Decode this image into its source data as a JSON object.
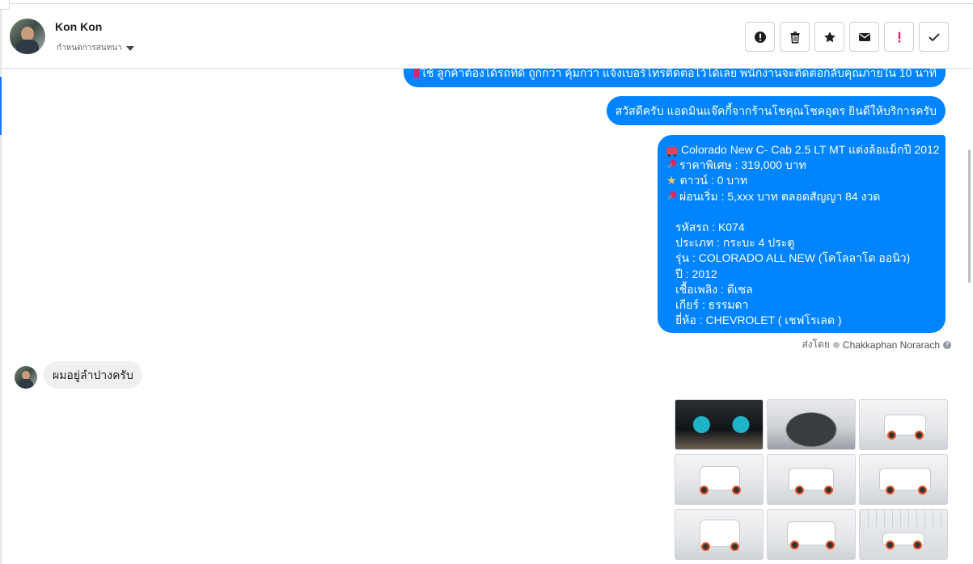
{
  "header": {
    "contact_name": "Kon Kon",
    "stage_label": "กำหนดการสนทนา"
  },
  "actions": [
    {
      "name": "spam-button",
      "icon": "alert-circle-icon"
    },
    {
      "name": "delete-button",
      "icon": "trash-icon"
    },
    {
      "name": "star-button",
      "icon": "star-icon"
    },
    {
      "name": "mark-unread-button",
      "icon": "envelope-icon"
    },
    {
      "name": "follow-up-button",
      "icon": "exclamation-icon"
    },
    {
      "name": "mark-done-button",
      "icon": "checkmark-icon"
    }
  ],
  "messages": {
    "out1_text": "ใช้ ลูกค้าต้องได้รถที่ดี ถูกกว่า คุ้มกว่า แจ้งเบอร์โทรติดต่อไว้ได้เลย พนักงานจะติดต่อกลับคุณภายใน 10 นาที",
    "out2_text": "สวัสดีครับ แอดมินแจ๊คกี้จากร้านโชคุณโชคอุดร ยินดีให้บริการครับ",
    "out3": {
      "title": "Colorado New C- Cab 2.5 LT MT แต่งล้อแม็กปี 2012",
      "price": "ราคาพิเศษ : 319,000 บาท",
      "down": "ดาวน์ : 0 บาท",
      "installment": "ผ่อนเริ่ม : 5,xxx บาท ตลอดสัญญา 84 งวด",
      "code": "รหัสรถ : K074",
      "type": "ประเภท : กระบะ 4 ประตู",
      "model": "รุ่น : COLORADO ALL NEW (โคโลลาโด ออนิว)",
      "year": "ปี : 2012",
      "fuel": "เชื้อเพลิง : ดีเซล",
      "gear": "เกียร์ : ธรรมดา",
      "brand": "ยี่ห้อ : CHEVROLET ( เชฟโรเลต )"
    },
    "sent_by_prefix": "ส่งโดย",
    "sent_by_agent": "Chakkaphan Norarach",
    "in1_text": "ผมอยู่ลำปางครับ"
  },
  "colors": {
    "outgoing_bubble": "#0084ff",
    "incoming_bubble": "#f0f0f0",
    "follow_up_red": "#e0245e"
  }
}
